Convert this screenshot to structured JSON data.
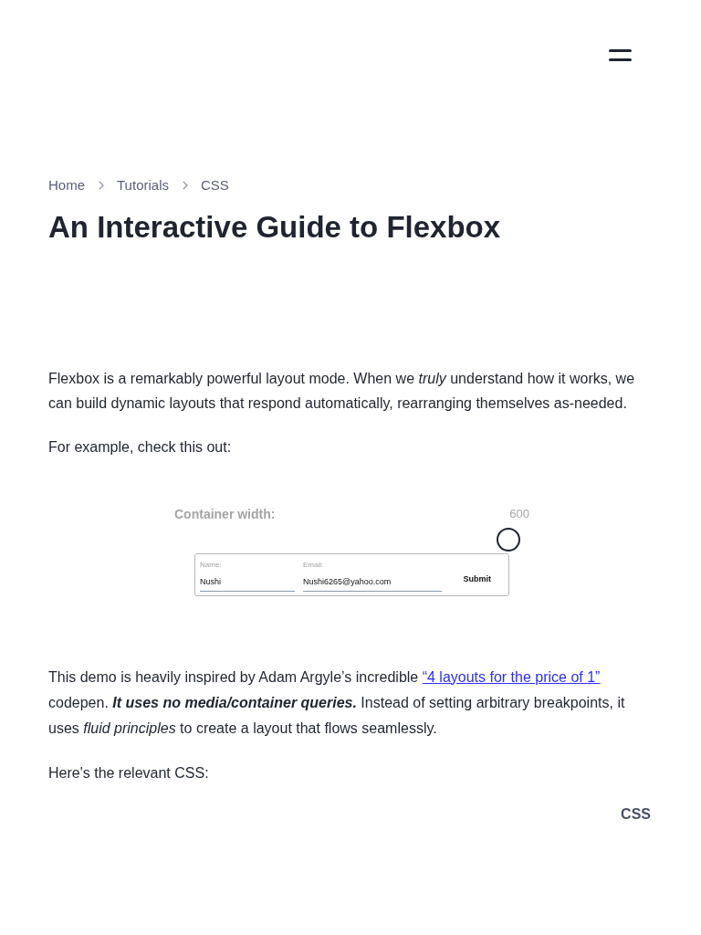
{
  "breadcrumbs": [
    {
      "label": "Home"
    },
    {
      "label": "Tutorials"
    },
    {
      "label": "CSS"
    }
  ],
  "title": "An Interactive Guide to Flexbox",
  "intro": "Flexbox is a remarkably powerful layout mode. When we *truly* understand how it works, we can build dynamic layouts that respond automatically, rearranging themselves as-needed.",
  "example_lead": "For example, check this out:",
  "demo": {
    "slider_label": "Container width:",
    "slider_value": "600",
    "level": 0.97,
    "fields": [
      {
        "label": "Name:",
        "value": "Nushi"
      },
      {
        "label": "Email:",
        "value": "Nushi6265@yahoo.com"
      }
    ],
    "submit": "Submit"
  },
  "inspiration": {
    "before": "This demo is heavily inspired by Adam Argyle’s incredible ",
    "link": "“4 layouts for the price of 1”",
    "after": " codepen. ",
    "emphasis": "It uses no media/container queries.",
    "rest": " Instead of setting arbitrary breakpoints, it uses *fluid principles* to create a layout that flows seamlessly."
  },
  "css_lead": "Here's the relevant CSS:",
  "code_tab": "CSS"
}
